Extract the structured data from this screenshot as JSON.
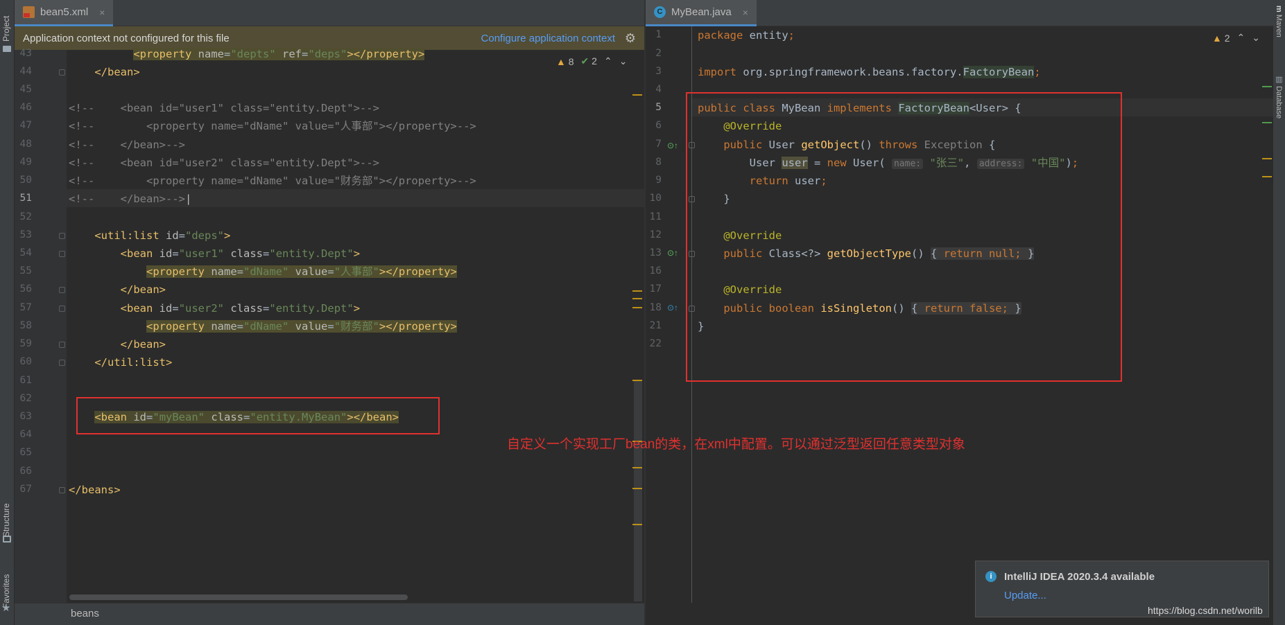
{
  "left_tool_window": {
    "project_label": "Project",
    "structure_label": "Structure",
    "favorites_label": "Favorites"
  },
  "right_tool_window": {
    "maven_label": "Maven",
    "database_label": "Database"
  },
  "left_editor": {
    "tab": {
      "label": "bean5.xml",
      "close": "×",
      "icon": "xml-file-icon"
    },
    "banner": {
      "message": "Application context not configured for this file",
      "link": "Configure application context",
      "icon": "gear-icon"
    },
    "inspections": {
      "warnings": "8",
      "weak_warnings": "2"
    },
    "line_numbers": [
      "43",
      "44",
      "45",
      "46",
      "47",
      "48",
      "49",
      "50",
      "51",
      "52",
      "53",
      "54",
      "55",
      "56",
      "57",
      "58",
      "59",
      "60",
      "61",
      "62",
      "63",
      "64",
      "65",
      "66",
      "67"
    ],
    "current_line": "51",
    "breadcrumb": "beans"
  },
  "right_editor": {
    "tab": {
      "label": "MyBean.java",
      "close": "×",
      "icon": "class-icon",
      "icon_letter": "C"
    },
    "inspections": {
      "warnings": "2"
    },
    "line_numbers": [
      "1",
      "2",
      "3",
      "4",
      "5",
      "6",
      "7",
      "8",
      "9",
      "10",
      "11",
      "12",
      "13",
      "16",
      "17",
      "18",
      "21",
      "22"
    ],
    "current_line": "5",
    "hints": {
      "name": "name:",
      "address": "address:"
    }
  },
  "annotation_text": "自定义一个实现工厂bean的类，在xml中配置。可以通过泛型返回任意类型对象",
  "notification": {
    "title": "IntelliJ IDEA 2020.3.4 available",
    "link": "Update...",
    "icon": "info-icon"
  },
  "watermark": "https://blog.csdn.net/worilb",
  "colors": {
    "editor_bg": "#2b2b2b",
    "panel_bg": "#3c3f41",
    "annotation_red": "#e0312f",
    "link_blue": "#589df6"
  }
}
